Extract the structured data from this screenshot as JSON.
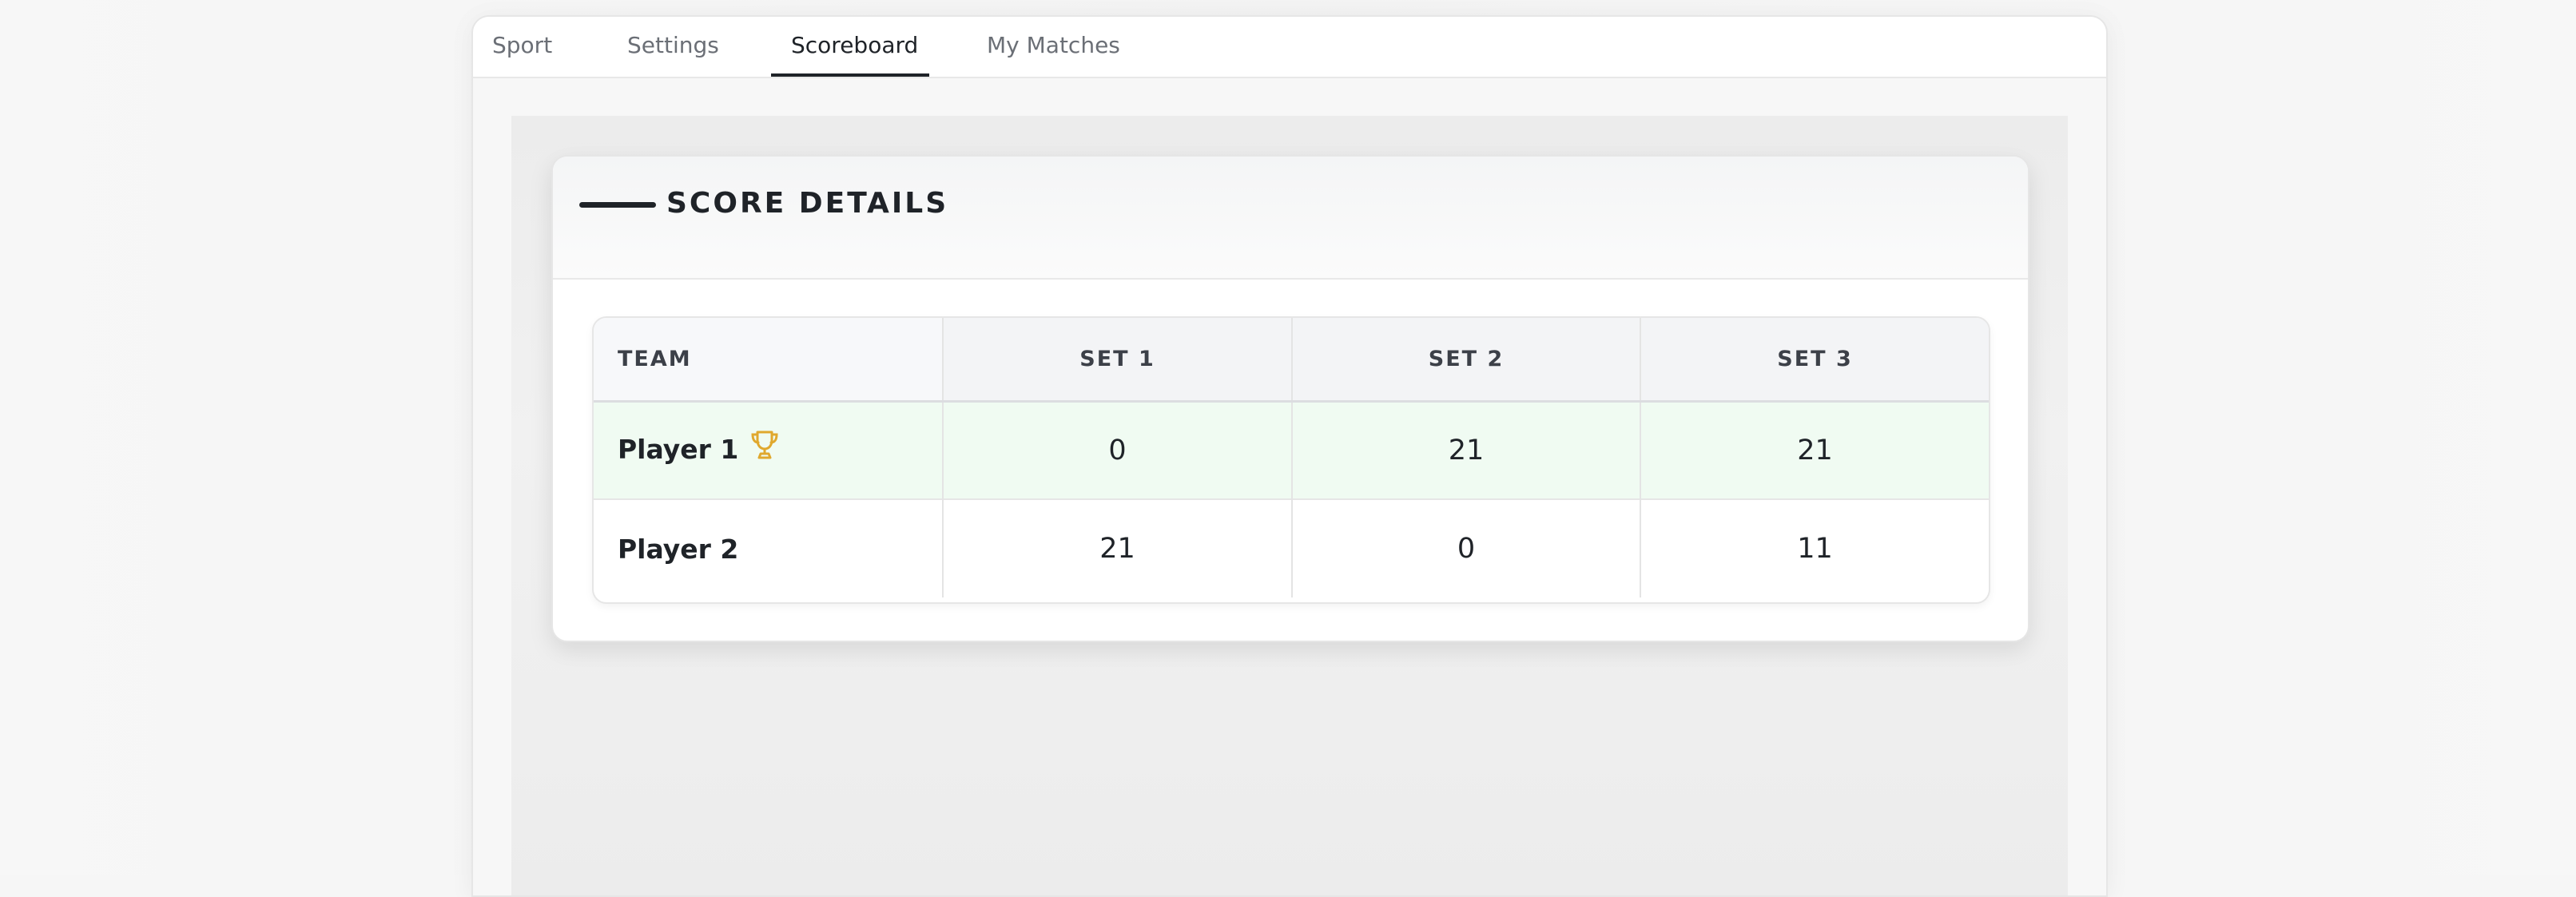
{
  "tabs": [
    {
      "label": "Sport",
      "active": false
    },
    {
      "label": "Settings",
      "active": false
    },
    {
      "label": "Scoreboard",
      "active": true
    },
    {
      "label": "My Matches",
      "active": false
    }
  ],
  "score_card": {
    "title": "SCORE DETAILS",
    "columns": [
      "TEAM",
      "SET 1",
      "SET 2",
      "SET 3"
    ],
    "rows": [
      {
        "team": "Player 1",
        "winner": true,
        "icon": "trophy-icon",
        "sets": [
          "0",
          "21",
          "21"
        ]
      },
      {
        "team": "Player 2",
        "winner": false,
        "sets": [
          "21",
          "0",
          "11"
        ]
      }
    ]
  },
  "colors": {
    "accent": "#1f2328",
    "winner_row": "#f0fbf2",
    "trophy": "#e0a82e"
  }
}
